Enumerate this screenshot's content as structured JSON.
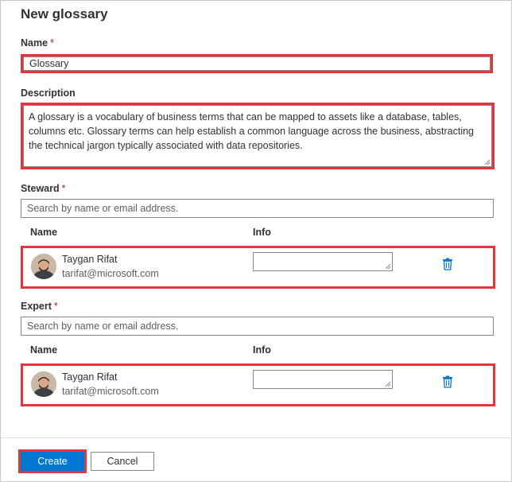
{
  "dialog": {
    "title": "New glossary"
  },
  "name_field": {
    "label": "Name",
    "required": "*",
    "value": "Glossary"
  },
  "description_field": {
    "label": "Description",
    "lines": [
      "A glossary is a vocabulary of business terms that can be mapped to assets like a database, tables,",
      "columns etc. Glossary terms can help establish a common language across the business, abstracting",
      "the technical jargon typically associated with data repositories."
    ]
  },
  "steward": {
    "label": "Steward",
    "required": "*",
    "search_placeholder": "Search by name or email address.",
    "columns": {
      "name": "Name",
      "info": "Info"
    },
    "person": {
      "name": "Taygan Rifat",
      "email": "tarifat@microsoft.com",
      "delete_icon": "trash-icon"
    }
  },
  "expert": {
    "label": "Expert",
    "required": "*",
    "search_placeholder": "Search by name or email address.",
    "columns": {
      "name": "Name",
      "info": "Info"
    },
    "person": {
      "name": "Taygan Rifat",
      "email": "tarifat@microsoft.com",
      "delete_icon": "trash-icon"
    }
  },
  "footer": {
    "create_label": "Create",
    "cancel_label": "Cancel"
  },
  "colors": {
    "accent": "#0078d4",
    "highlight": "#e8323c",
    "required": "#a4262c"
  }
}
